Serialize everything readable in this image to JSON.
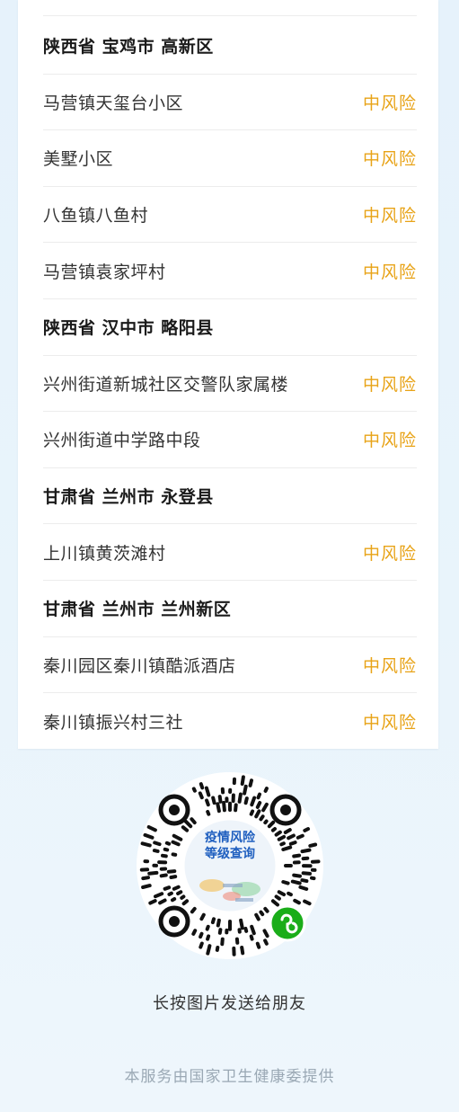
{
  "risk_list": {
    "rows": [
      {
        "type": "header",
        "region": "陕西省 宝鸡市 高新区"
      },
      {
        "type": "item",
        "place": "马营镇天玺台小区",
        "risk": "中风险"
      },
      {
        "type": "item",
        "place": "美墅小区",
        "risk": "中风险"
      },
      {
        "type": "item",
        "place": "八鱼镇八鱼村",
        "risk": "中风险"
      },
      {
        "type": "item",
        "place": "马营镇袁家坪村",
        "risk": "中风险"
      },
      {
        "type": "header",
        "region": "陕西省 汉中市 略阳县"
      },
      {
        "type": "item",
        "place": "兴州街道新城社区交警队家属楼",
        "risk": "中风险"
      },
      {
        "type": "item",
        "place": "兴州街道中学路中段",
        "risk": "中风险"
      },
      {
        "type": "header",
        "region": "甘肃省 兰州市 永登县"
      },
      {
        "type": "item",
        "place": "上川镇黄茨滩村",
        "risk": "中风险"
      },
      {
        "type": "header",
        "region": "甘肃省 兰州市 兰州新区"
      },
      {
        "type": "item",
        "place": "秦川园区秦川镇酷派酒店",
        "risk": "中风险"
      },
      {
        "type": "item",
        "place": "秦川镇振兴村三社",
        "risk": "中风险"
      }
    ]
  },
  "mini_program_code": {
    "center_text_line1": "疫情风险",
    "center_text_line2": "等级查询",
    "badge_icon": "wechat-mini-program-icon",
    "badge_color": "#1aad19"
  },
  "caption": "长按图片发送给朋友",
  "footer": "本服务由国家卫生健康委提供",
  "colors": {
    "risk_medium": "#e8a317",
    "page_background": "#e6f2fb",
    "card_background": "#ffffff",
    "qr_center_text": "#1f5fbf"
  }
}
